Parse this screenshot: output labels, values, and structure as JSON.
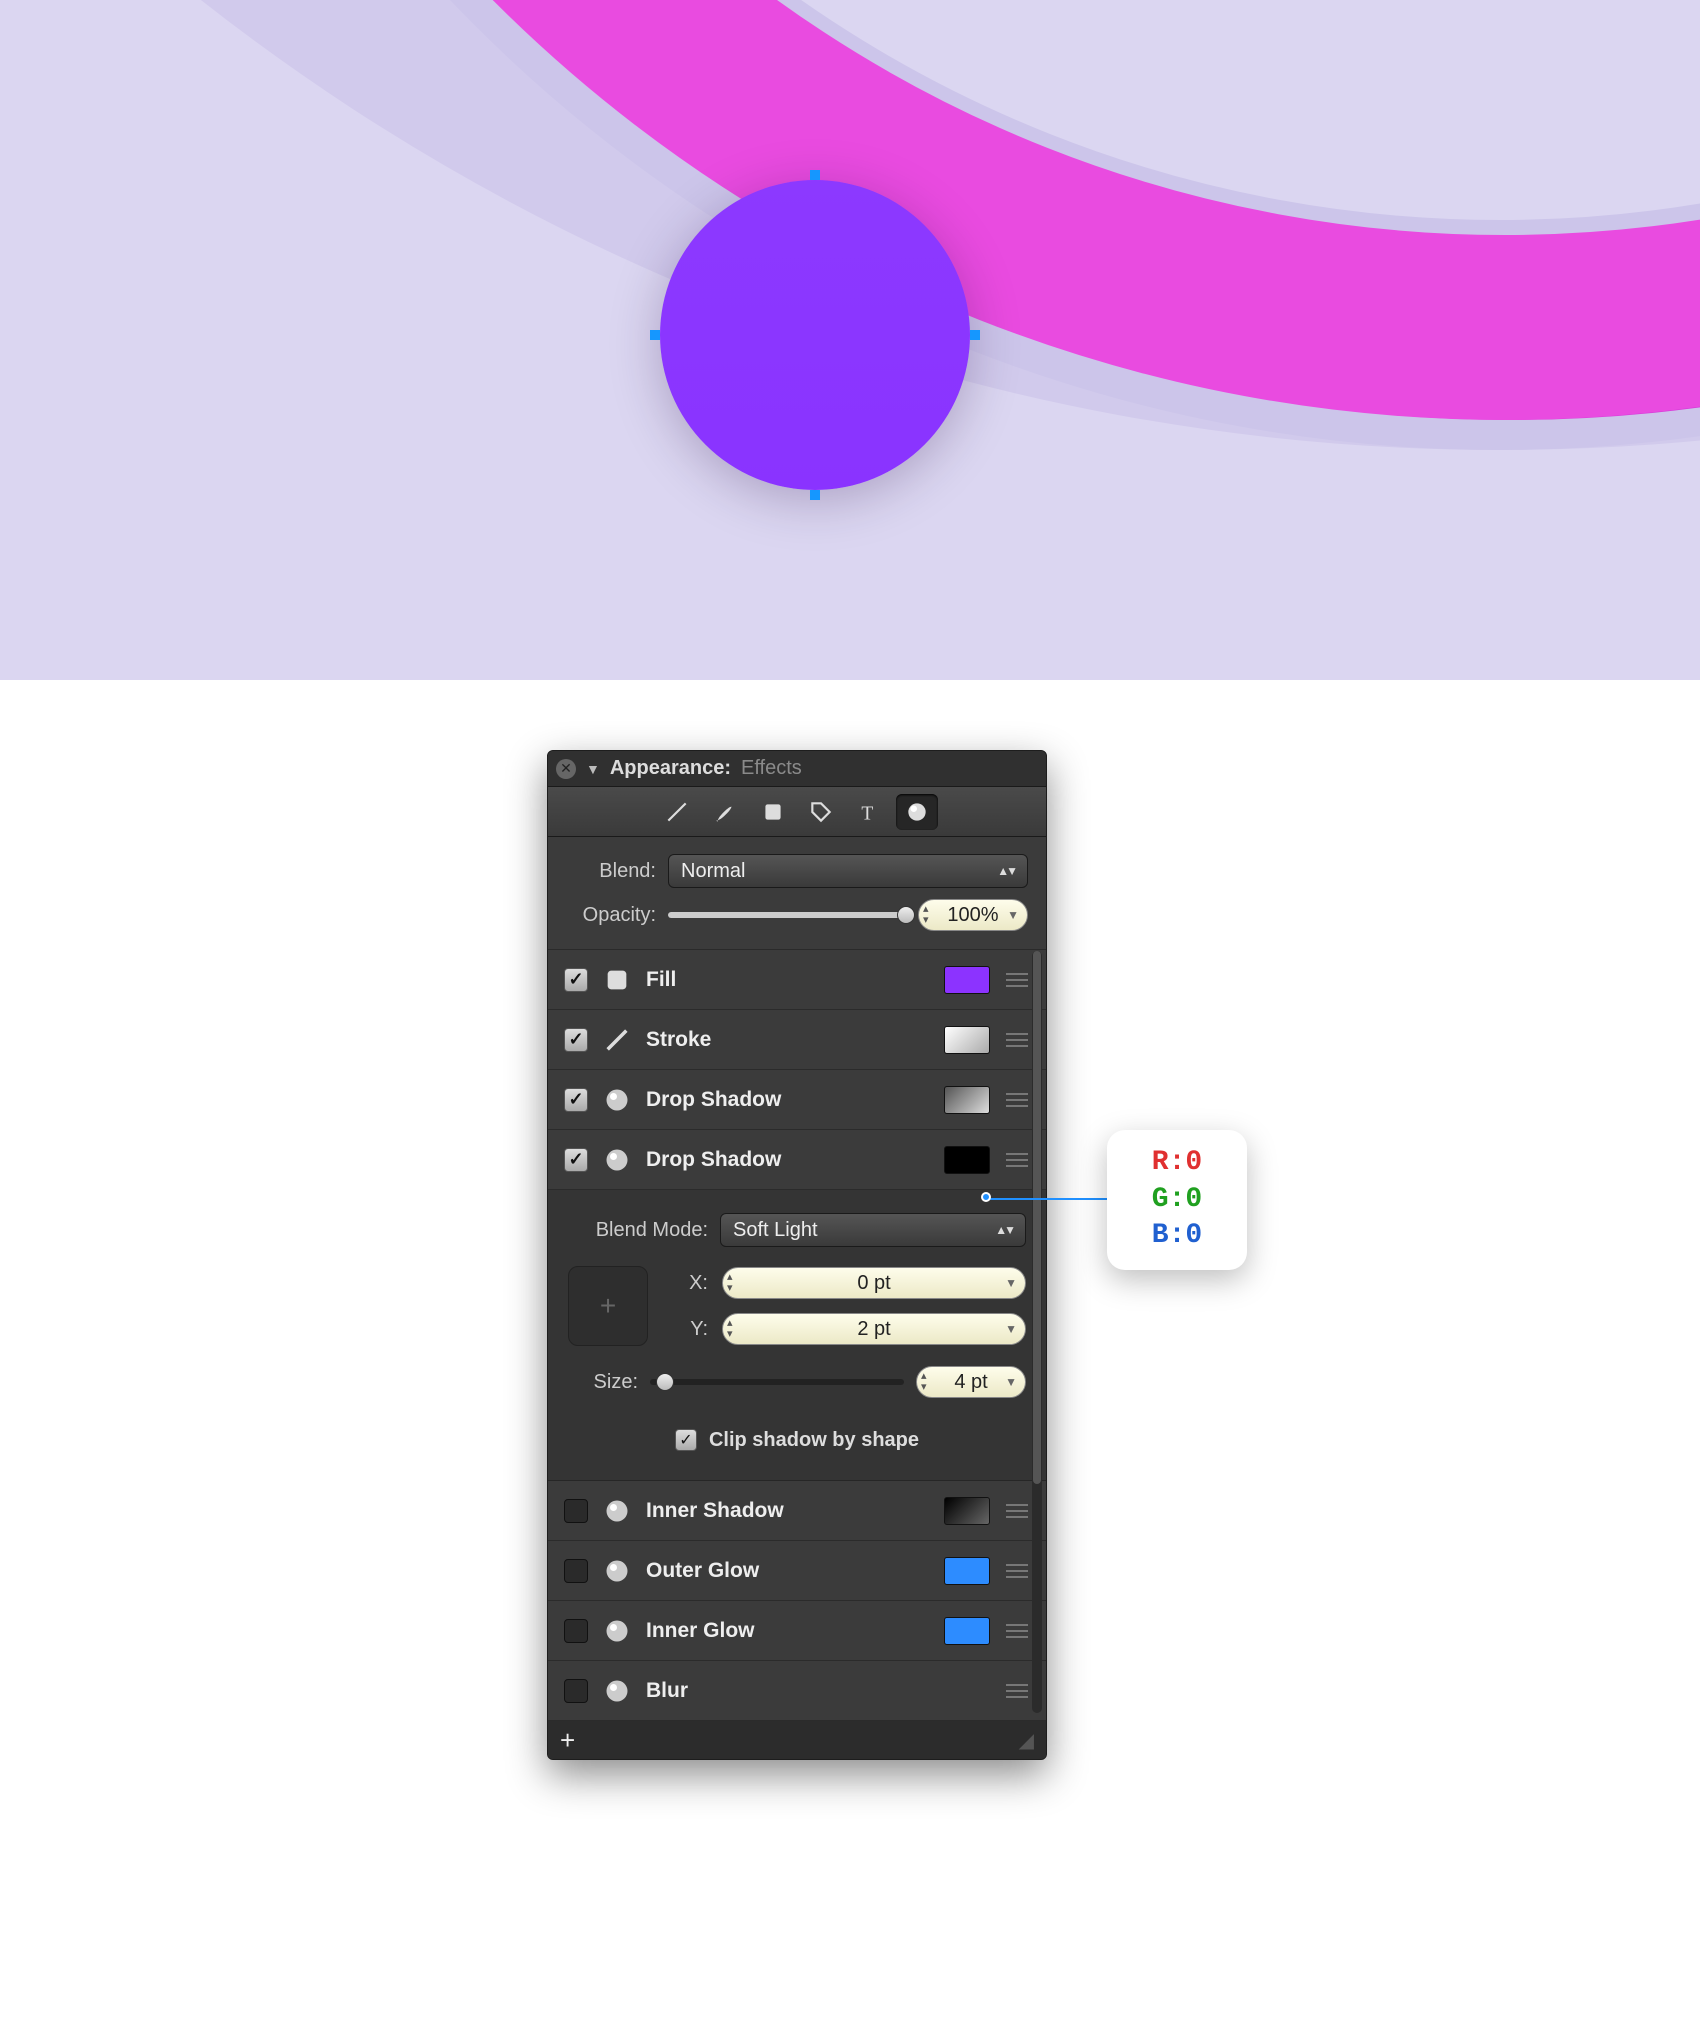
{
  "panel": {
    "title_prefix": "Appearance:",
    "title_suffix": "Effects",
    "blend_label": "Blend:",
    "blend_value": "Normal",
    "opacity_label": "Opacity:",
    "opacity_value": "100%",
    "opacity_pct": 100,
    "blendmode_label": "Blend Mode:",
    "blendmode_value": "Soft Light",
    "x_label": "X:",
    "x_value": "0 pt",
    "y_label": "Y:",
    "y_value": "2 pt",
    "size_label": "Size:",
    "size_value": "4 pt",
    "size_pct": 6,
    "clip_label": "Clip shadow by shape",
    "effects": [
      {
        "name": "Fill",
        "checked": true,
        "swatch": "#8C33FF",
        "icon": "fill"
      },
      {
        "name": "Stroke",
        "checked": true,
        "swatch": "linear-gradient(135deg,#fff,#aaa)",
        "icon": "stroke"
      },
      {
        "name": "Drop Shadow",
        "checked": true,
        "swatch": "linear-gradient(135deg,#555,#ddd)",
        "icon": "sphere"
      },
      {
        "name": "Drop Shadow",
        "checked": true,
        "swatch": "#000",
        "icon": "sphere",
        "expanded": true
      },
      {
        "name": "Inner Shadow",
        "checked": false,
        "swatch": "linear-gradient(135deg,#000,#666)",
        "icon": "sphere"
      },
      {
        "name": "Outer Glow",
        "checked": false,
        "swatch": "#2D8CFF",
        "icon": "sphere"
      },
      {
        "name": "Inner Glow",
        "checked": false,
        "swatch": "#2D8CFF",
        "icon": "sphere"
      },
      {
        "name": "Blur",
        "checked": false,
        "swatch": "",
        "icon": "sphere"
      }
    ]
  },
  "callout": {
    "r": "R:0",
    "g": "G:0",
    "b": "B:0"
  }
}
